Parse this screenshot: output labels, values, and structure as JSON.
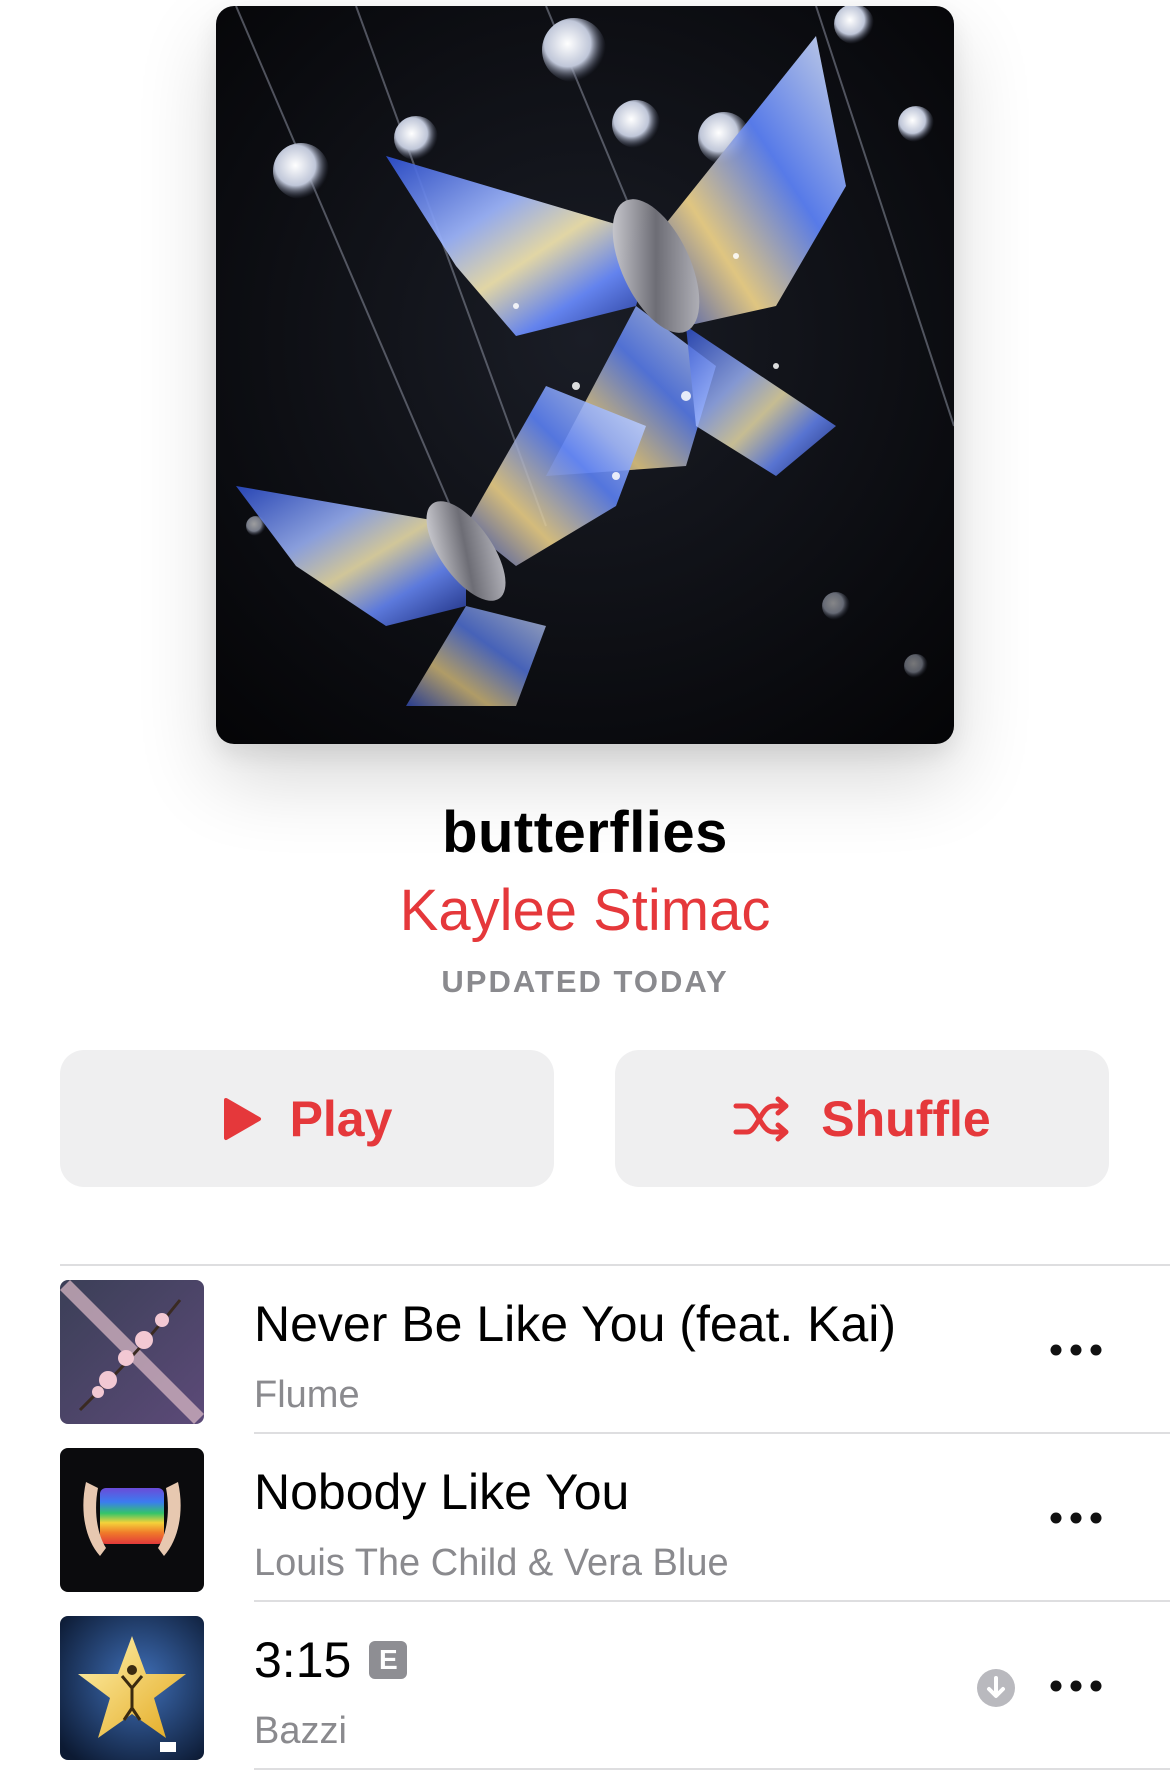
{
  "playlist": {
    "title": "butterflies",
    "curator": "Kaylee Stimac",
    "updated": "UPDATED TODAY"
  },
  "actions": {
    "play_label": "Play",
    "shuffle_label": "Shuffle",
    "accent": "#e5383b"
  },
  "tracks": [
    {
      "title": "Never Be Like You (feat. Kai)",
      "artist": "Flume",
      "explicit": false,
      "downloaded": false
    },
    {
      "title": "Nobody Like You",
      "artist": "Louis The Child & Vera Blue",
      "explicit": false,
      "downloaded": false
    },
    {
      "title": "3:15",
      "artist": "Bazzi",
      "explicit": true,
      "explicit_badge": "E",
      "downloaded": true
    }
  ],
  "icons": {
    "play": "play-icon",
    "shuffle": "shuffle-icon",
    "more": "ellipsis-icon",
    "download": "download-icon"
  }
}
